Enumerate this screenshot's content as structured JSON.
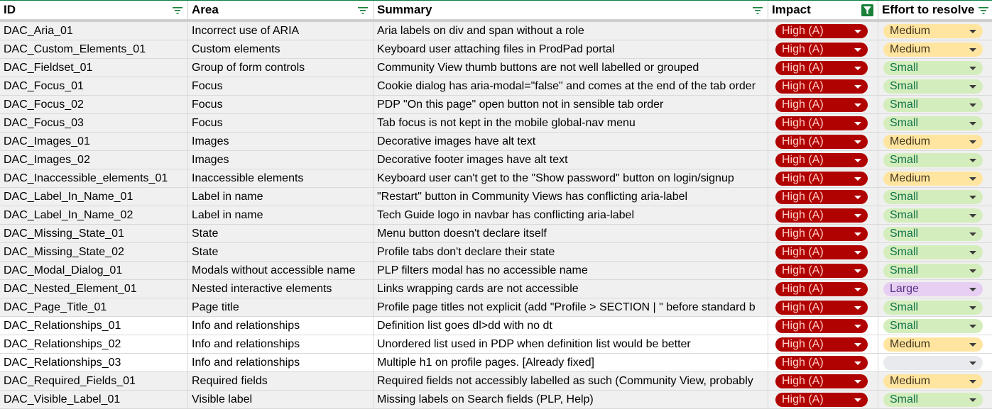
{
  "headers": {
    "id": "ID",
    "area": "Area",
    "summary": "Summary",
    "impact": "Impact",
    "effort": "Effort to resolve"
  },
  "colors": {
    "header_border": "#0b8043",
    "impact_chip": "#b10202",
    "effort_medium": "#ffe5a0",
    "effort_small": "#d4edbc",
    "effort_large": "#e6cff2",
    "active_filter": "#188038"
  },
  "rows": [
    {
      "id": "DAC_Aria_01",
      "area": "Incorrect use of ARIA",
      "summary": "Aria labels on div and span without a role",
      "impact": "High (A)",
      "effort": "Medium",
      "shade": "shaded"
    },
    {
      "id": "DAC_Custom_Elements_01",
      "area": "Custom elements",
      "summary": "Keyboard user attaching files in ProdPad portal",
      "impact": "High (A)",
      "effort": "Medium",
      "shade": "shaded"
    },
    {
      "id": "DAC_Fieldset_01",
      "area": "Group of form controls",
      "summary": "Community View thumb buttons are not well labelled or grouped",
      "impact": "High (A)",
      "effort": "Small",
      "shade": "shaded"
    },
    {
      "id": "DAC_Focus_01",
      "area": "Focus",
      "summary": "Cookie dialog has aria-modal=\"false\" and comes at the end of the tab order",
      "impact": "High (A)",
      "effort": "Small",
      "shade": "shaded"
    },
    {
      "id": "DAC_Focus_02",
      "area": "Focus",
      "summary": "PDP \"On this page\" open button not in sensible tab order",
      "impact": "High (A)",
      "effort": "Small",
      "shade": "shaded"
    },
    {
      "id": "DAC_Focus_03",
      "area": "Focus",
      "summary": "Tab focus is not kept in the mobile global-nav menu",
      "impact": "High (A)",
      "effort": "Small",
      "shade": "shaded"
    },
    {
      "id": "DAC_Images_01",
      "area": "Images",
      "summary": "Decorative images have alt text",
      "impact": "High (A)",
      "effort": "Medium",
      "shade": "shaded"
    },
    {
      "id": "DAC_Images_02",
      "area": "Images",
      "summary": "Decorative footer images have alt text",
      "impact": "High (A)",
      "effort": "Small",
      "shade": "shaded"
    },
    {
      "id": "DAC_Inaccessible_elements_01",
      "area": "Inaccessible elements",
      "summary": "Keyboard user can't get to the \"Show password\" button on login/signup",
      "impact": "High (A)",
      "effort": "Medium",
      "shade": "shaded"
    },
    {
      "id": "DAC_Label_In_Name_01",
      "area": "Label in name",
      "summary": "\"Restart\" button in Community Views has conflicting aria-label",
      "impact": "High (A)",
      "effort": "Small",
      "shade": "shaded"
    },
    {
      "id": "DAC_Label_In_Name_02",
      "area": "Label in name",
      "summary": "Tech Guide logo in navbar has conflicting aria-label",
      "impact": "High (A)",
      "effort": "Small",
      "shade": "shaded"
    },
    {
      "id": "DAC_Missing_State_01",
      "area": "State",
      "summary": "Menu button doesn't declare itself",
      "impact": "High (A)",
      "effort": "Small",
      "shade": "shaded"
    },
    {
      "id": "DAC_Missing_State_02",
      "area": "State",
      "summary": "Profile tabs don't declare their state",
      "impact": "High (A)",
      "effort": "Small",
      "shade": "shaded"
    },
    {
      "id": "DAC_Modal_Dialog_01",
      "area": "Modals without accessible name",
      "summary": "PLP filters modal has no accessible name",
      "impact": "High (A)",
      "effort": "Small",
      "shade": "shaded"
    },
    {
      "id": "DAC_Nested_Element_01",
      "area": "Nested interactive elements",
      "summary": "Links wrapping cards are not accessible",
      "impact": "High (A)",
      "effort": "Large",
      "shade": "shaded"
    },
    {
      "id": "DAC_Page_Title_01",
      "area": "Page title",
      "summary": "Profile page titles not explicit (add \"Profile > SECTION | \" before standard b",
      "impact": "High (A)",
      "effort": "Small",
      "shade": "shaded"
    },
    {
      "id": "DAC_Relationships_01",
      "area": "Info and relationships",
      "summary": "Definition list goes dl>dd with no dt",
      "impact": "High (A)",
      "effort": "Small",
      "shade": "white"
    },
    {
      "id": "DAC_Relationships_02",
      "area": "Info and relationships",
      "summary": "Unordered list used in PDP when definition list would be better",
      "impact": "High (A)",
      "effort": "Medium",
      "shade": "white"
    },
    {
      "id": "DAC_Relationships_03",
      "area": "Info and relationships",
      "summary": "Multiple h1 on profile pages. [Already fixed]",
      "impact": "High (A)",
      "effort": "",
      "shade": "white"
    },
    {
      "id": "DAC_Required_Fields_01",
      "area": "Required fields",
      "summary": "Required fields not accessibly labelled as such (Community View, probably",
      "impact": "High (A)",
      "effort": "Medium",
      "shade": "shaded"
    },
    {
      "id": "DAC_Visible_Label_01",
      "area": "Visible label",
      "summary": "Missing labels on Search fields (PLP, Help)",
      "impact": "High (A)",
      "effort": "Small",
      "shade": "shaded"
    }
  ]
}
